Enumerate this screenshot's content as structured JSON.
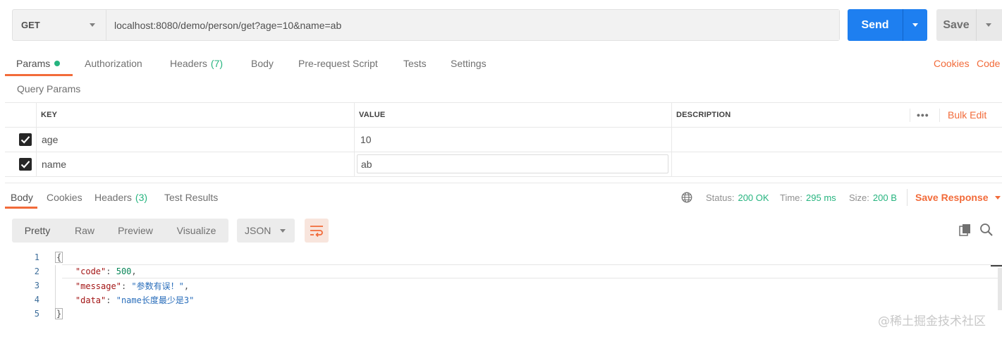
{
  "request": {
    "method": "GET",
    "url": "localhost:8080/demo/person/get?age=10&name=ab",
    "send_label": "Send",
    "save_label": "Save"
  },
  "request_tabs": {
    "params": "Params",
    "authorization": "Authorization",
    "headers": "Headers",
    "headers_count": "(7)",
    "body": "Body",
    "pre_request": "Pre-request Script",
    "tests": "Tests",
    "settings": "Settings",
    "cookies_link": "Cookies",
    "code_link": "Code"
  },
  "query_params": {
    "title": "Query Params",
    "columns": {
      "key": "KEY",
      "value": "VALUE",
      "description": "DESCRIPTION"
    },
    "bulk_edit": "Bulk Edit",
    "more": "•••",
    "rows": [
      {
        "checked": true,
        "key": "age",
        "value": "10",
        "description": ""
      },
      {
        "checked": true,
        "key": "name",
        "value": "ab",
        "description": ""
      }
    ]
  },
  "response_tabs": {
    "body": "Body",
    "cookies": "Cookies",
    "headers": "Headers",
    "headers_count": "(3)",
    "test_results": "Test Results"
  },
  "response_status": {
    "status_label": "Status:",
    "status_value": "200 OK",
    "time_label": "Time:",
    "time_value": "295 ms",
    "size_label": "Size:",
    "size_value": "200 B",
    "save_response": "Save Response"
  },
  "response_view": {
    "modes": [
      "Pretty",
      "Raw",
      "Preview",
      "Visualize"
    ],
    "active_mode": "Pretty",
    "format": "JSON"
  },
  "response_body": {
    "line_numbers": [
      "1",
      "2",
      "3",
      "4",
      "5"
    ],
    "open_brace": "{",
    "close_brace": "}",
    "code_key": "\"code\"",
    "code_value": "500",
    "message_key": "\"message\"",
    "message_value": "\"参数有误！\"",
    "data_key": "\"data\"",
    "data_value": "\"name长度最少是3\""
  },
  "watermark": "@稀土掘金技术社区",
  "colors": {
    "accent_orange": "#f26b3a",
    "send_blue": "#1e7ff0",
    "status_green": "#26b47f"
  }
}
